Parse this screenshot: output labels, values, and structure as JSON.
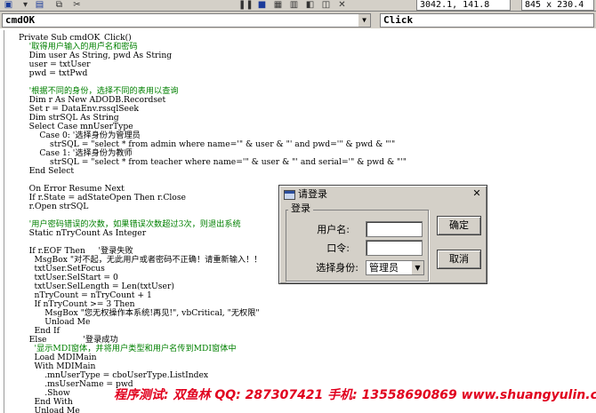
{
  "toolbar": {
    "coordinates": "3042.1, 141.8",
    "size": "845 x 230.4"
  },
  "object_combo": {
    "value": "cmdOK"
  },
  "procedure_combo": {
    "value": "Click"
  },
  "code": {
    "lines": [
      {
        "text": "Private Sub cmdOK_Click()",
        "comment": false
      },
      {
        "text": "    '取得用户输入的用户名和密码",
        "comment": true
      },
      {
        "text": "    Dim user As String, pwd As String",
        "comment": false
      },
      {
        "text": "    user = txtUser",
        "comment": false
      },
      {
        "text": "    pwd = txtPwd",
        "comment": false
      },
      {
        "text": "",
        "comment": false
      },
      {
        "text": "    '根据不同的身份，选择不同的表用以查询",
        "comment": true
      },
      {
        "text": "    Dim r As New ADODB.Recordset",
        "comment": false
      },
      {
        "text": "    Set r = DataEnv.rssqlSeek",
        "comment": false
      },
      {
        "text": "    Dim strSQL As String",
        "comment": false
      },
      {
        "text": "    Select Case mnUserType",
        "comment": false
      },
      {
        "text": "        Case 0: '选择身份为管理员",
        "comment": false
      },
      {
        "text": "            strSQL = \"select * from admin where name='\" & user & \"' and pwd='\" & pwd & \"'\"",
        "comment": false
      },
      {
        "text": "        Case 1: '选择身份为教师",
        "comment": false
      },
      {
        "text": "            strSQL = \"select * from teacher where name='\" & user & \"' and serial='\" & pwd & \"'\"",
        "comment": false
      },
      {
        "text": "    End Select",
        "comment": false
      },
      {
        "text": "",
        "comment": false
      },
      {
        "text": "    On Error Resume Next",
        "comment": false
      },
      {
        "text": "    If r.State = adStateOpen Then r.Close",
        "comment": false
      },
      {
        "text": "    r.Open strSQL",
        "comment": false
      },
      {
        "text": "",
        "comment": false
      },
      {
        "text": "    '用户密码错误的次数，如果错误次数超过3次，则退出系统",
        "comment": true
      },
      {
        "text": "    Static nTryCount As Integer",
        "comment": false
      },
      {
        "text": "",
        "comment": false
      },
      {
        "text": "    If r.EOF Then     '登录失败",
        "comment": false
      },
      {
        "text": "      MsgBox \"对不起，无此用户或者密码不正确！请重新输入！！",
        "comment": false
      },
      {
        "text": "      txtUser.SetFocus",
        "comment": false
      },
      {
        "text": "      txtUser.SelStart = 0",
        "comment": false
      },
      {
        "text": "      txtUser.SelLength = Len(txtUser)",
        "comment": false
      },
      {
        "text": "      nTryCount = nTryCount + 1",
        "comment": false
      },
      {
        "text": "      If nTryCount >= 3 Then",
        "comment": false
      },
      {
        "text": "          MsgBox \"您无权操作本系统!再见!\", vbCritical, \"无权限\"",
        "comment": false
      },
      {
        "text": "          Unload Me",
        "comment": false
      },
      {
        "text": "      End If",
        "comment": false
      },
      {
        "text": "    Else              '登录成功",
        "comment": false
      },
      {
        "text": "      '显示MDI窗体，并将用户类型和用户名传到MDI窗体中",
        "comment": true
      },
      {
        "text": "      Load MDIMain",
        "comment": false
      },
      {
        "text": "      With MDIMain",
        "comment": false
      },
      {
        "text": "          .mnUserType = cboUserType.ListIndex",
        "comment": false
      },
      {
        "text": "          .msUserName = pwd",
        "comment": false
      },
      {
        "text": "          .Show",
        "comment": false
      },
      {
        "text": "      End With",
        "comment": false
      },
      {
        "text": "      Unload Me",
        "comment": false
      },
      {
        "text": "    End If",
        "comment": false
      }
    ]
  },
  "dialog": {
    "title": "请登录",
    "group_label": "登录",
    "username_label": "用户名:",
    "username_value": "",
    "password_label": "口令:",
    "password_value": "",
    "identity_label": "选择身份:",
    "identity_value": "管理员",
    "ok_label": "确定",
    "cancel_label": "取消"
  },
  "watermark": {
    "text": "程序测试: 双鱼林   QQ: 287307421  手机: 13558690869   www.shuangyulin.com"
  }
}
